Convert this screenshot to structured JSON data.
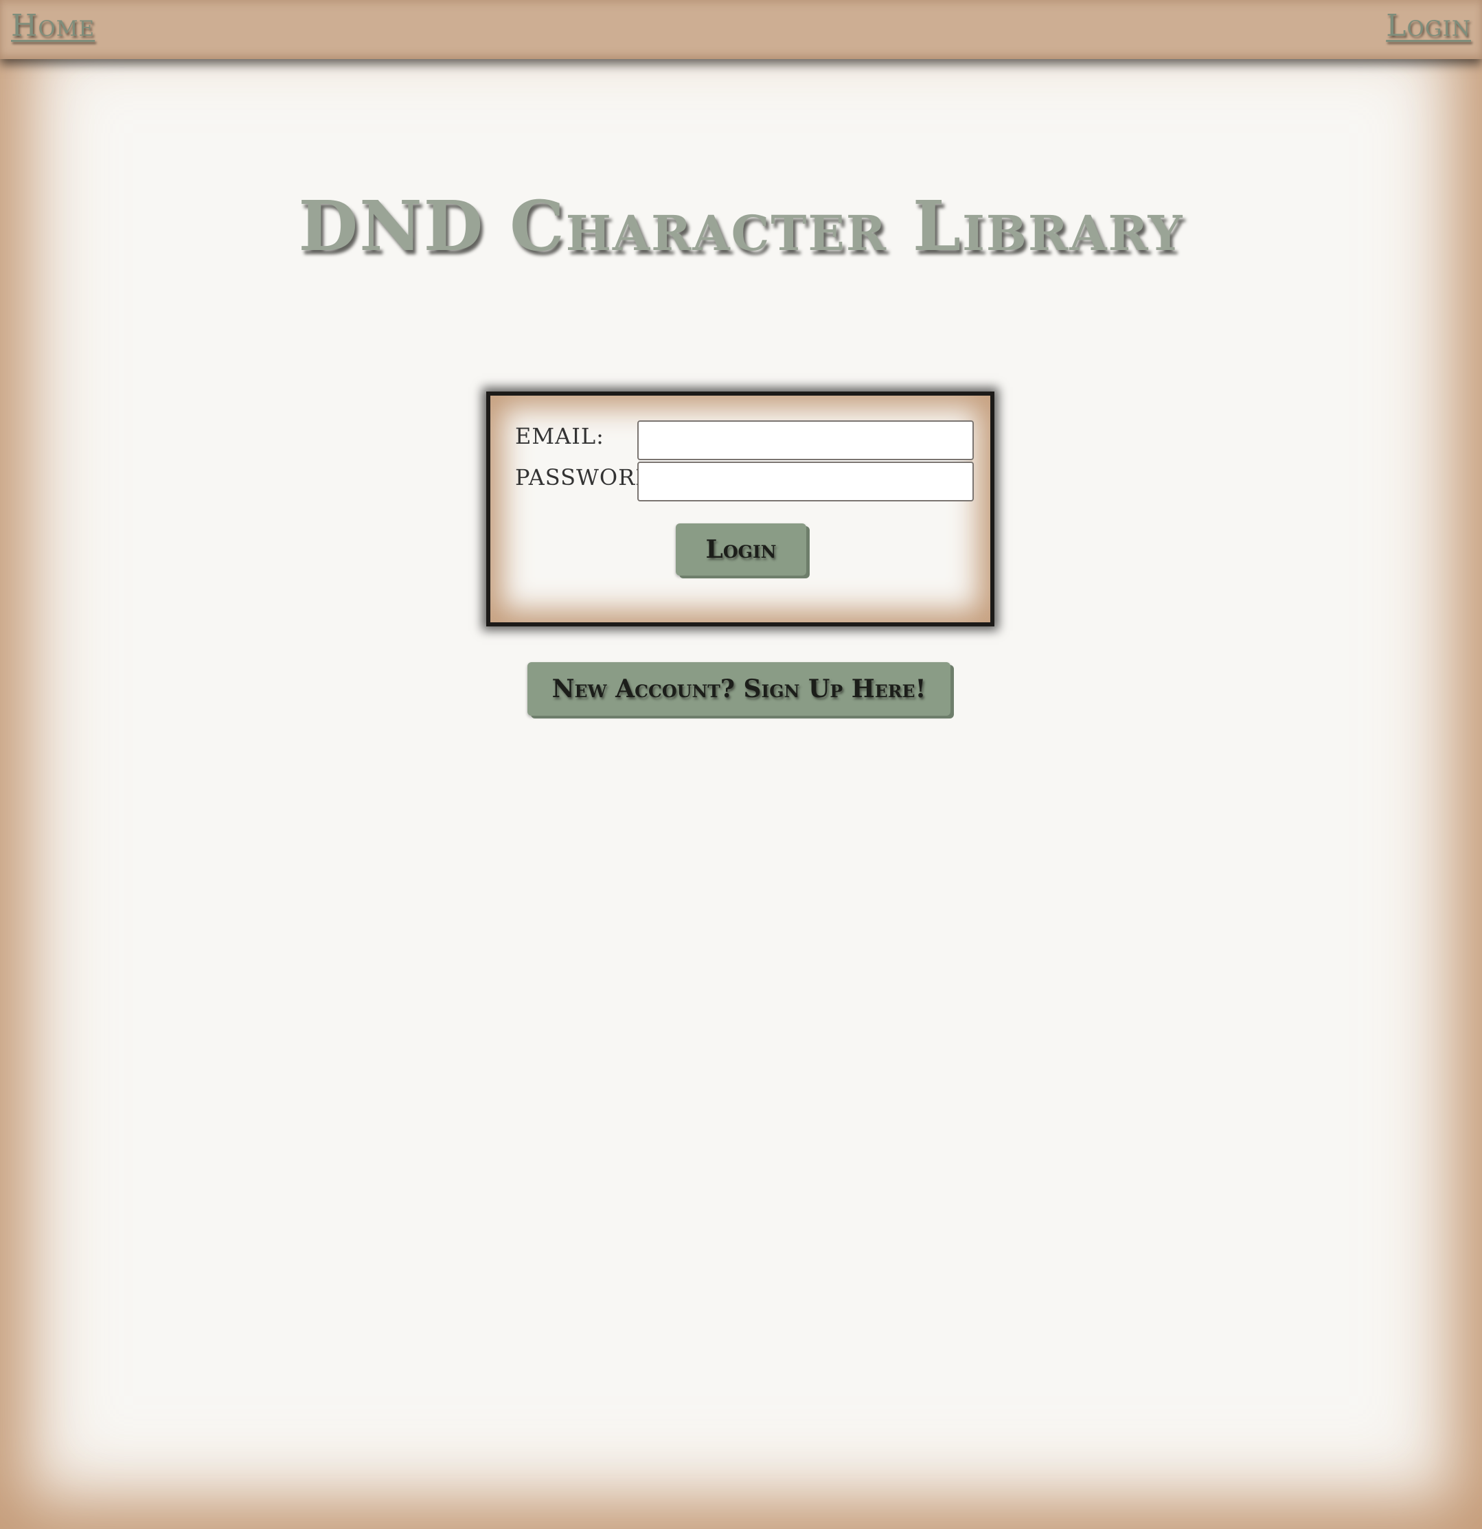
{
  "nav": {
    "home_label": "Home",
    "login_label": "Login"
  },
  "page": {
    "title": "DND Character Library"
  },
  "login_form": {
    "email_label": "EMAIL:",
    "email_value": "",
    "password_label": "PASSWORD:",
    "password_value": "",
    "submit_label": "Login"
  },
  "signup": {
    "button_label": "New Account? Sign Up Here!"
  },
  "colors": {
    "navbar_bg": "#cdae93",
    "page_bg": "#f8f7f4",
    "frame_edge": "#c49b78",
    "accent_green": "#8a9c86",
    "title_color": "#9aa496"
  }
}
